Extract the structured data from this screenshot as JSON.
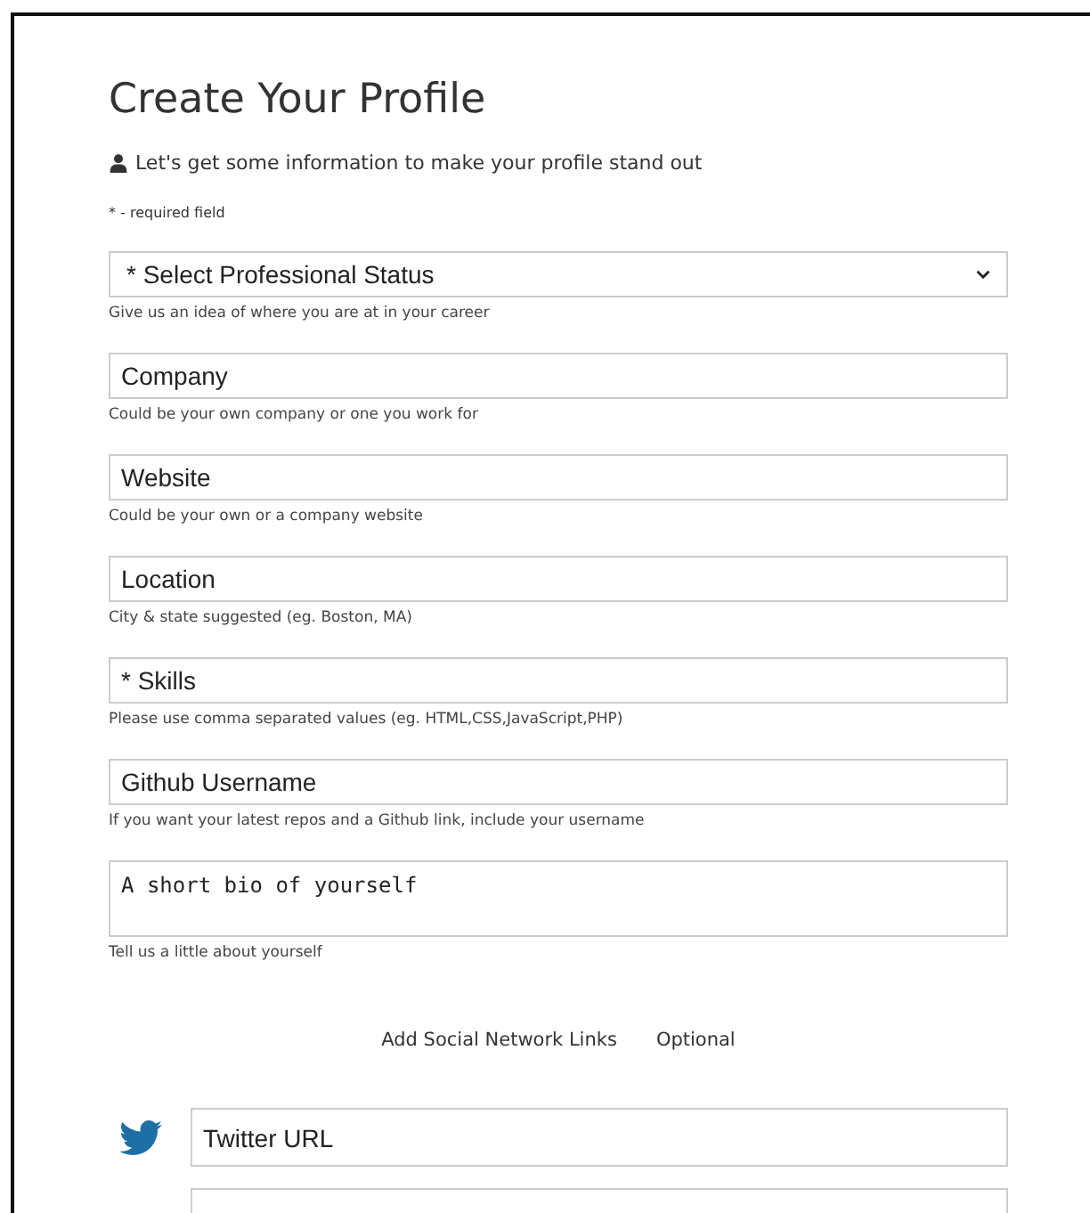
{
  "title": "Create Your Profile",
  "lead": "Let's get some information to make your profile stand out",
  "required_note": "* - required field",
  "fields": [
    {
      "kind": "select",
      "placeholder": "* Select Professional Status",
      "hint": "Give us an idea of where you are at in your career"
    },
    {
      "kind": "input",
      "placeholder": "Company",
      "hint": "Could be your own company or one you work for"
    },
    {
      "kind": "input",
      "placeholder": "Website",
      "hint": "Could be your own or a company website"
    },
    {
      "kind": "input",
      "placeholder": "Location",
      "hint": "City & state suggested (eg. Boston, MA)"
    },
    {
      "kind": "input",
      "placeholder": "* Skills",
      "hint": "Please use comma separated values (eg. HTML,CSS,JavaScript,PHP)"
    },
    {
      "kind": "input",
      "placeholder": "Github Username",
      "hint": "If you want your latest repos and a Github link, include your username"
    },
    {
      "kind": "textarea",
      "placeholder": "A short bio of yourself",
      "hint": "Tell us a little about yourself"
    }
  ],
  "social_toggle": {
    "label": "Add Social Network Links",
    "note": "Optional"
  },
  "social_links": [
    {
      "kind": "bird",
      "placeholder": "Twitter URL"
    },
    {
      "kind": "blank"
    }
  ]
}
